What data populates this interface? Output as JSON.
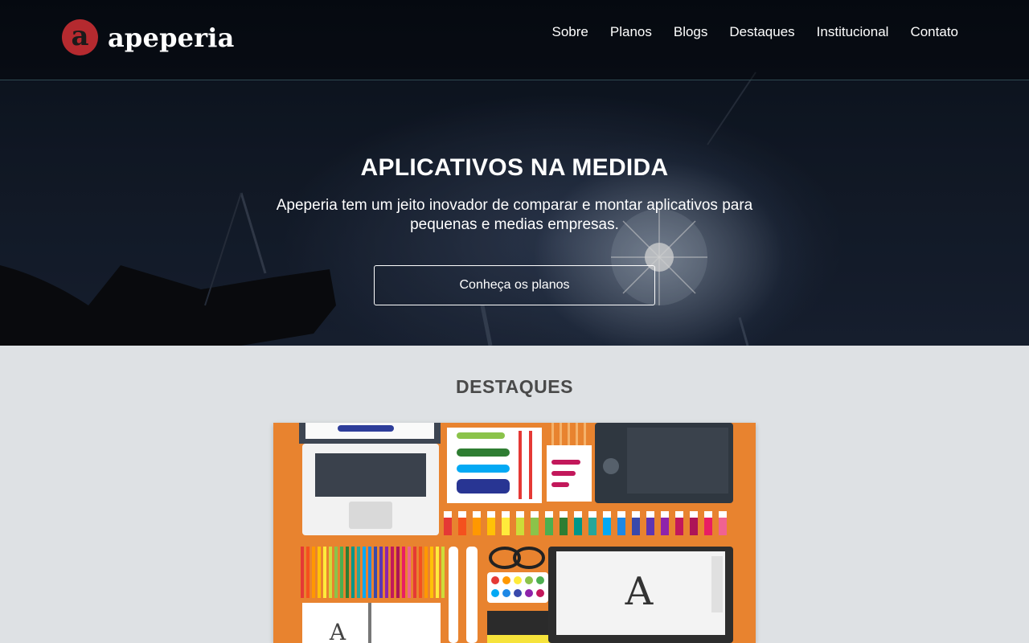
{
  "brand": {
    "logo_letter": "a",
    "name": "apeperia"
  },
  "nav": {
    "items": [
      "Sobre",
      "Planos",
      "Blogs",
      "Destaques",
      "Institucional",
      "Contato"
    ]
  },
  "hero": {
    "title": "APLICATIVOS NA MEDIDA",
    "subtitle": "Apeperia tem um jeito inovador de comparar e montar aplicativos para pequenas e medias empresas.",
    "cta_label": "Conheça os planos"
  },
  "features": {
    "title": "DESTAQUES"
  },
  "colors": {
    "brand_red": "#b52a2f",
    "feature_orange": "#e8832f",
    "page_bg": "#dee1e4"
  }
}
